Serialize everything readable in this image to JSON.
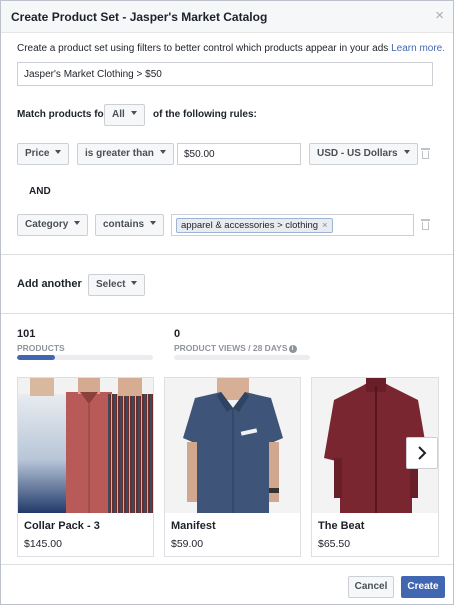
{
  "dialog": {
    "title": "Create Product Set - Jasper's Market Catalog",
    "close_glyph": "×"
  },
  "intro": {
    "text": "Create a product set using filters to better control which products appear in your ads",
    "link": "Learn more."
  },
  "set_name": {
    "value": "Jasper's Market Clothing > $50"
  },
  "match": {
    "prefix": "Match products for",
    "mode": "All",
    "suffix": "of the following rules:"
  },
  "rules": [
    {
      "field": "Price",
      "operator": "is greater than",
      "value": "$50.00",
      "currency": "USD - US Dollars"
    },
    {
      "field": "Category",
      "operator": "contains",
      "token": "apparel & accessories > clothing"
    }
  ],
  "conjunction": "AND",
  "add_another": {
    "label": "Add another",
    "select": "Select"
  },
  "stats": {
    "products": {
      "count": "101",
      "label": "PRODUCTS",
      "fill_fraction": 0.28
    },
    "views": {
      "count": "0",
      "label": "PRODUCT VIEWS / 28 DAYS",
      "fill_fraction": 0
    }
  },
  "products": [
    {
      "name": "Collar Pack - 3",
      "price": "$145.00"
    },
    {
      "name": "Manifest",
      "price": "$59.00"
    },
    {
      "name": "The Beat",
      "price": "$65.50"
    }
  ],
  "footer": {
    "cancel": "Cancel",
    "create": "Create"
  },
  "colors": {
    "accent": "#4267b2",
    "header_bg": "#f6f7f9",
    "border": "#ccd0d5"
  },
  "icons": [
    "close-icon",
    "caret-down-icon",
    "trash-icon",
    "token-remove-icon",
    "info-icon",
    "chevron-right-icon"
  ]
}
